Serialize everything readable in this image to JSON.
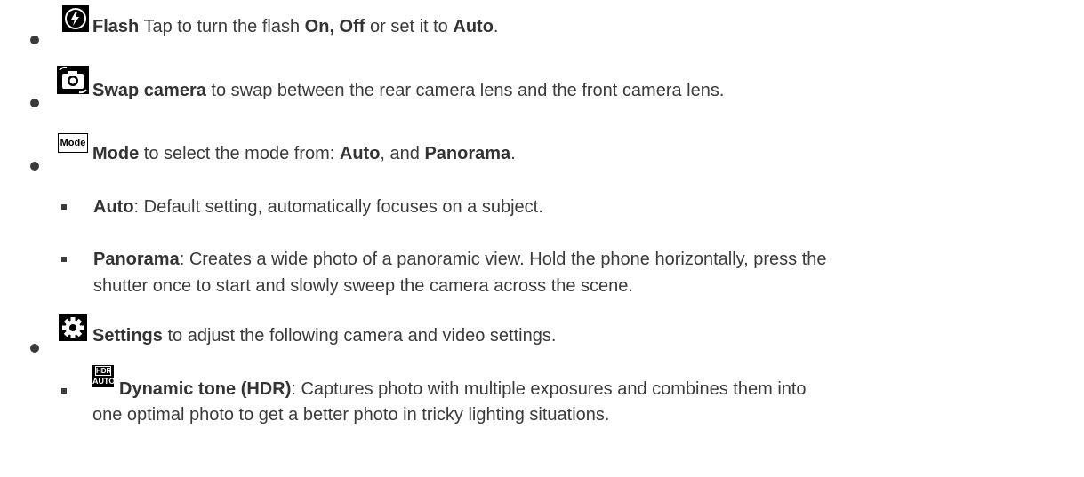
{
  "items": [
    {
      "icon": "flash-auto-icon",
      "title": "Flash",
      "text_1": " Tap to turn the flash ",
      "bold_1": "On, Off",
      "text_2": " or set it to ",
      "bold_2": "Auto",
      "text_3": "."
    },
    {
      "icon": "swap-camera-icon",
      "title": "Swap camera",
      "text_1": " to swap between the rear camera lens and the front camera lens."
    },
    {
      "icon": "mode-icon",
      "icon_label": "Mode",
      "title": "Mode",
      "text_1": " to select the mode from: ",
      "bold_1": "Auto",
      "text_2": ", and ",
      "bold_2": "Panorama",
      "text_3": ".",
      "subitems": [
        {
          "title": "Auto",
          "text_1": ": Default setting, automatically focuses on a subject."
        },
        {
          "title": "Panorama",
          "text_1": ": Creates a wide photo of a panoramic view. Hold the phone horizontally, press the",
          "text_2": "shutter once to start and slowly sweep the camera across the scene."
        }
      ]
    },
    {
      "icon": "settings-gear-icon",
      "title": "Settings",
      "text_1": " to adjust the following camera and video settings.",
      "subitems": [
        {
          "icon": "hdr-auto-icon",
          "icon_label_top": "HDR",
          "icon_label_bottom": "AUTO",
          "title": "Dynamic tone (HDR)",
          "text_1": ": Captures photo with multiple exposures and combines them into",
          "text_2": "one optimal photo to get a better photo in tricky lighting situations."
        }
      ]
    }
  ]
}
